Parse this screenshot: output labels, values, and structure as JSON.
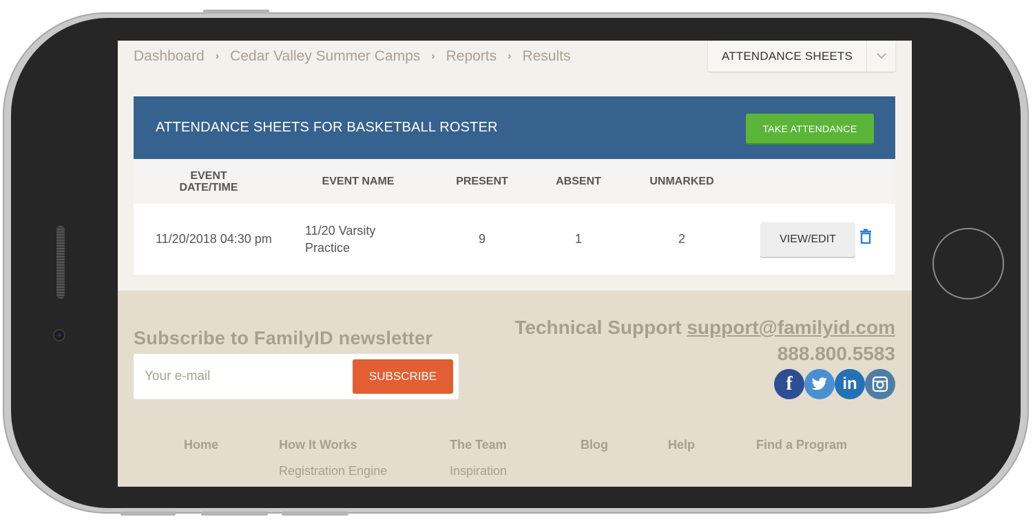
{
  "breadcrumb": {
    "items": [
      "Dashboard",
      "Cedar Valley Summer Camps",
      "Reports",
      "Results"
    ],
    "separator": "›"
  },
  "sheet_selector": {
    "selected": "ATTENDANCE SHEETS",
    "arrow_icon": "chevron-down-icon"
  },
  "panel": {
    "title": "ATTENDANCE SHEETS FOR BASKETBALL ROSTER",
    "take_attendance_label": "TAKE ATTENDANCE",
    "columns": [
      "EVENT DATE/TIME",
      "EVENT NAME",
      "PRESENT",
      "ABSENT",
      "UNMARKED"
    ],
    "rows": [
      {
        "event_datetime": "11/20/2018 04:30 pm",
        "event_name": "11/20 Varsity Practice",
        "present": "9",
        "absent": "1",
        "unmarked": "2",
        "view_edit_label": "VIEW/EDIT",
        "delete_icon": "trash-icon"
      }
    ]
  },
  "footer": {
    "newsletter_title": "Subscribe to FamilyID newsletter",
    "email_placeholder": "Your e-mail",
    "subscribe_label": "SUBSCRIBE",
    "support_label": "Technical Support",
    "support_email": "support@familyid.com",
    "support_phone": "888.800.5583",
    "social_icons": [
      "facebook-icon",
      "twitter-icon",
      "linkedin-icon",
      "instagram-icon"
    ],
    "nav": {
      "home": "Home",
      "how_it_works": "How It Works",
      "the_team": "The Team",
      "blog": "Blog",
      "help": "Help",
      "find_program": "Find a Program",
      "registration_engine": "Registration Engine",
      "inspiration": "Inspiration"
    }
  },
  "colors": {
    "header_blue": "#35628e",
    "take_attendance_green": "#5bb539",
    "subscribe_orange": "#e15f32",
    "footer_bg": "#e4ddcd",
    "page_bg": "#f4f1ec"
  }
}
